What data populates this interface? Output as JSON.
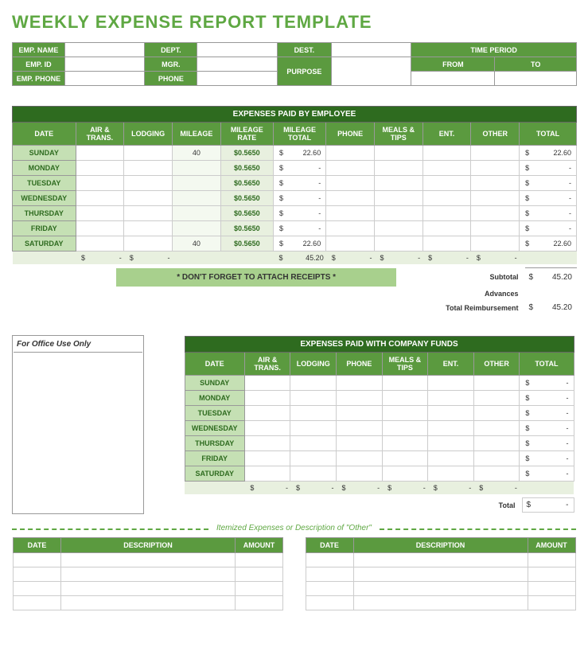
{
  "title": "WEEKLY EXPENSE REPORT TEMPLATE",
  "info": {
    "emp_name": "EMP. NAME",
    "emp_id": "EMP. ID",
    "emp_phone": "EMP. PHONE",
    "dept": "DEPT.",
    "mgr": "MGR.",
    "phone": "PHONE",
    "dest": "DEST.",
    "purpose": "PURPOSE",
    "time_period": "TIME PERIOD",
    "from": "FROM",
    "to": "TO"
  },
  "emp_section": "EXPENSES PAID BY EMPLOYEE",
  "cols": {
    "date": "DATE",
    "air": "AIR & TRANS.",
    "lodging": "LODGING",
    "mileage": "MILEAGE",
    "rate": "MILEAGE RATE",
    "mtotal": "MILEAGE TOTAL",
    "phone": "PHONE",
    "meals": "MEALS & TIPS",
    "ent": "ENT.",
    "other": "OTHER",
    "total": "TOTAL"
  },
  "days": [
    "SUNDAY",
    "MONDAY",
    "TUESDAY",
    "WEDNESDAY",
    "THURSDAY",
    "FRIDAY",
    "SATURDAY"
  ],
  "emp_rows": [
    {
      "mileage": "40",
      "rate": "$0.5650",
      "mtotal": "22.60",
      "total": "22.60"
    },
    {
      "mileage": "",
      "rate": "$0.5650",
      "mtotal": "-",
      "total": "-"
    },
    {
      "mileage": "",
      "rate": "$0.5650",
      "mtotal": "-",
      "total": "-"
    },
    {
      "mileage": "",
      "rate": "$0.5650",
      "mtotal": "-",
      "total": "-"
    },
    {
      "mileage": "",
      "rate": "$0.5650",
      "mtotal": "-",
      "total": "-"
    },
    {
      "mileage": "",
      "rate": "$0.5650",
      "mtotal": "-",
      "total": "-"
    },
    {
      "mileage": "40",
      "rate": "$0.5650",
      "mtotal": "22.60",
      "total": "22.60"
    }
  ],
  "emp_totals": {
    "mtotal": "45.20"
  },
  "reminder": "* DON'T FORGET TO ATTACH RECEIPTS *",
  "summary": {
    "subtotal_l": "Subtotal",
    "subtotal": "45.20",
    "advances_l": "Advances",
    "advances": "",
    "reimb_l": "Total Reimbursement",
    "reimb": "45.20"
  },
  "office": "For Office Use Only",
  "comp_section": "EXPENSES PAID WITH COMPANY FUNDS",
  "comp_total_l": "Total",
  "comp_total": "-",
  "itemized": "Itemized Expenses or Description of \"Other\"",
  "item_cols": {
    "date": "DATE",
    "desc": "DESCRIPTION",
    "amount": "AMOUNT"
  }
}
